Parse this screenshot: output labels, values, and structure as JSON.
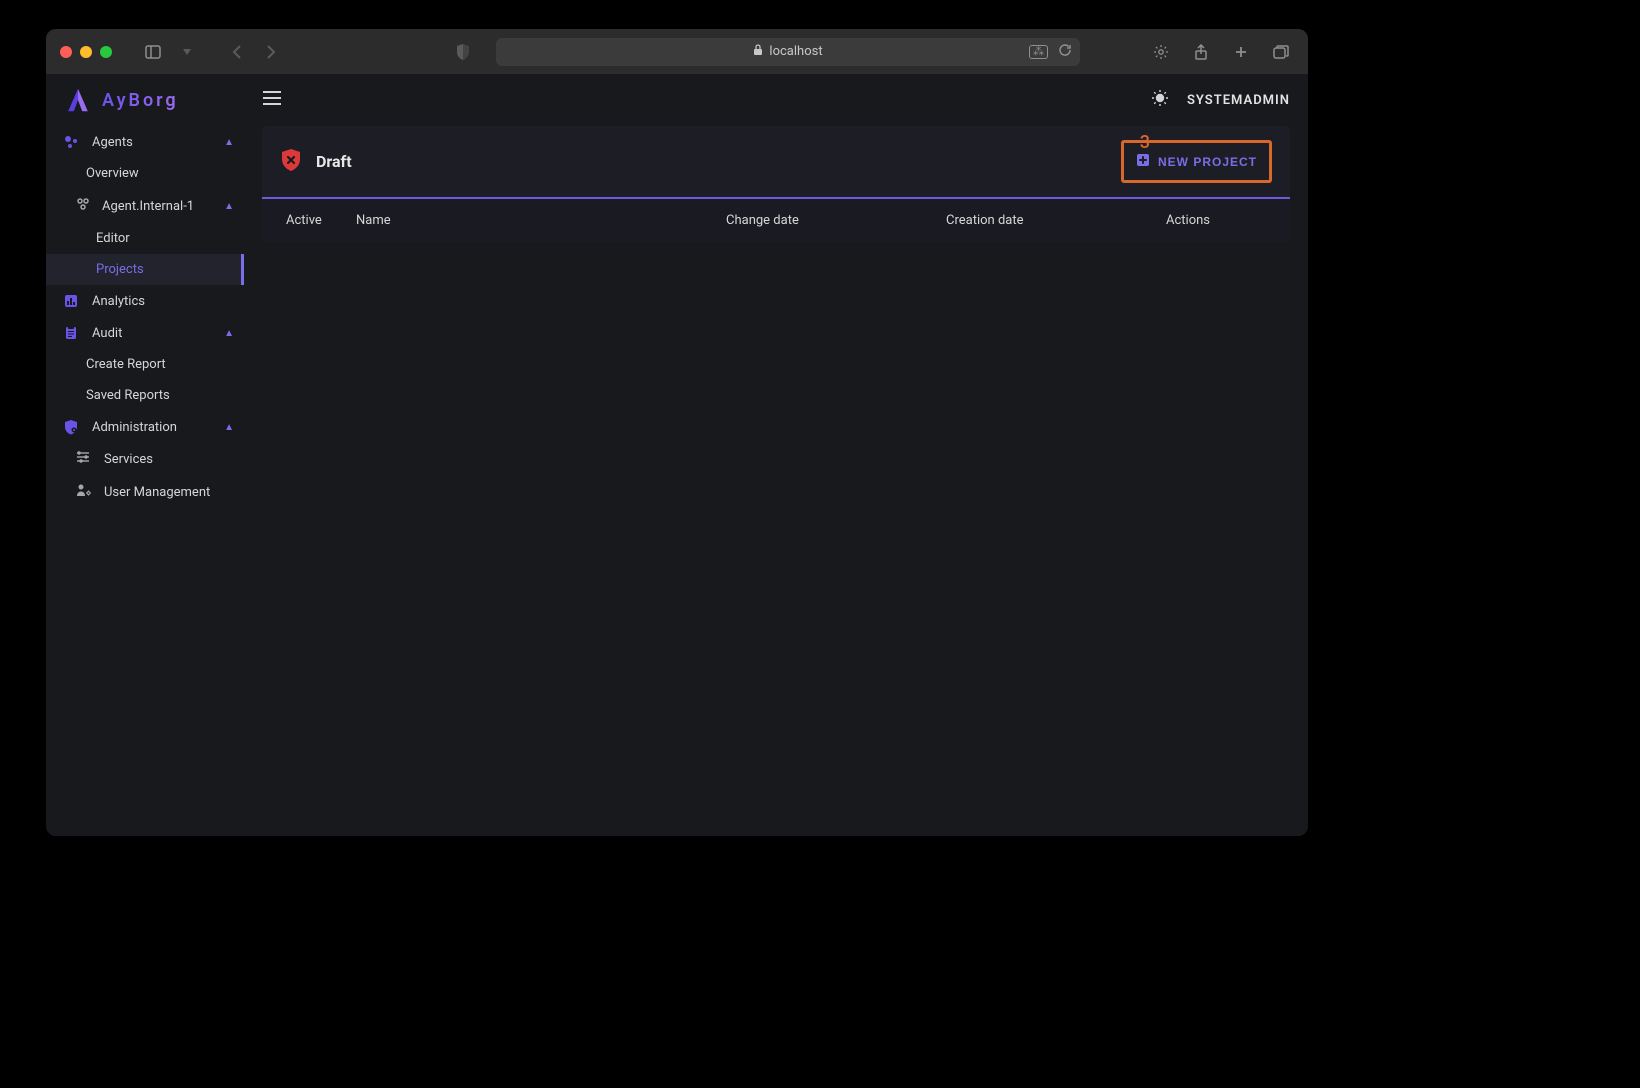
{
  "browser": {
    "url_host": "localhost"
  },
  "brand": {
    "name": "AyBorg"
  },
  "topbar": {
    "user": "SYSTEMADMIN"
  },
  "sidebar": {
    "agents": {
      "label": "Agents",
      "overview": "Overview",
      "agent1": {
        "label": "Agent.Internal-1",
        "editor": "Editor",
        "projects": "Projects"
      }
    },
    "analytics": {
      "label": "Analytics"
    },
    "audit": {
      "label": "Audit",
      "create_report": "Create Report",
      "saved_reports": "Saved Reports"
    },
    "administration": {
      "label": "Administration",
      "services": "Services",
      "user_management": "User Management"
    }
  },
  "panel": {
    "title": "Draft",
    "new_project_label": "NEW PROJECT",
    "annotation_number": "3",
    "columns": {
      "active": "Active",
      "name": "Name",
      "change_date": "Change date",
      "creation_date": "Creation date",
      "actions": "Actions"
    }
  }
}
